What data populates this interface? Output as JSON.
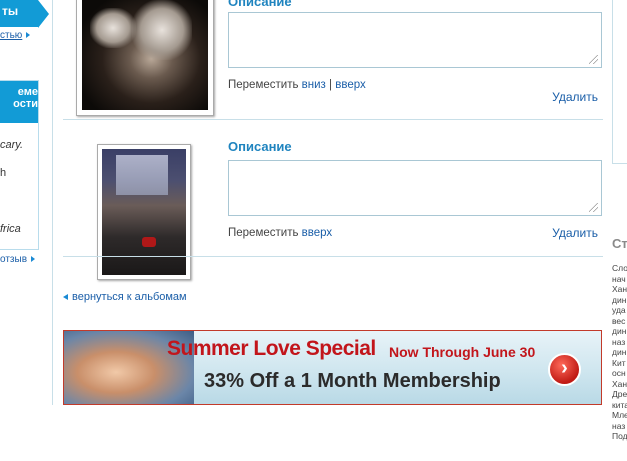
{
  "sidebar": {
    "top_tab_label": "ты",
    "top_link": "стью",
    "box_title_line1": "еме",
    "box_title_line2": "ости",
    "text_lines": [
      "cary.",
      "h",
      "frica"
    ],
    "bottom_link": "отзыв"
  },
  "photos": [
    {
      "description_label": "Описание",
      "description_value": "",
      "move_label": "Переместить",
      "move_down": "вниз",
      "separator": "|",
      "move_up": "вверх",
      "delete_label": "Удалить"
    },
    {
      "description_label": "Описание",
      "description_value": "",
      "move_label": "Переместить",
      "move_up": "вверх",
      "delete_label": "Удалить"
    }
  ],
  "back_link": "вернуться к альбомам",
  "banner": {
    "headline": "Summer Love Special",
    "subline": "Now Through June 30",
    "offer": "33% Off a 1 Month Membership",
    "button_glyph": "›"
  },
  "right_column": {
    "title": "Ст",
    "lines": [
      "Сло",
      "нач",
      "Хан",
      "дин",
      "уда",
      "вес",
      "дин",
      "наз",
      "дин",
      "Кит",
      "осн",
      "Хан",
      "Дре",
      "кита",
      "Мле",
      "наз",
      "Под"
    ]
  },
  "colors": {
    "accent": "#129bd6",
    "link": "#1a5ea8",
    "heading": "#1f84bf",
    "banner_red": "#c2151b"
  }
}
